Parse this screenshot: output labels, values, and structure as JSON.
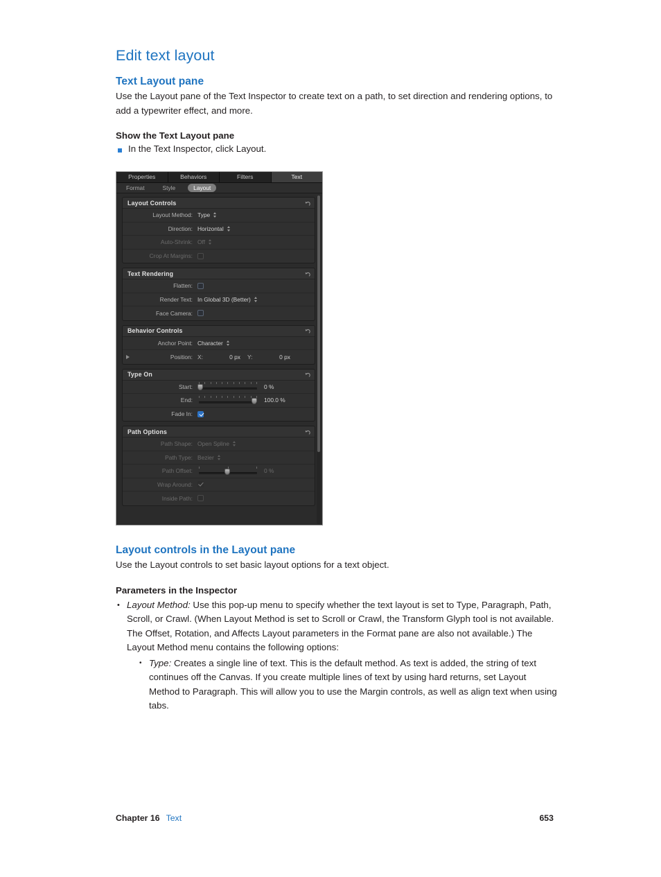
{
  "document": {
    "title": "Edit text layout",
    "sections": [
      {
        "heading": "Text Layout pane",
        "body": "Use the Layout pane of the Text Inspector to create text on a path, to set direction and rendering options, to add a typewriter effect, and more.",
        "subheading": "Show the Text Layout pane",
        "bullet": "In the Text Inspector, click Layout."
      },
      {
        "heading": "Layout controls in the Layout pane",
        "body": "Use the Layout controls to set basic layout options for a text object.",
        "subheading": "Parameters in the Inspector",
        "item_term": "Layout Method:",
        "item_text": " Use this pop-up menu to specify whether the text layout is set to Type, Paragraph, Path, Scroll, or Crawl. (When Layout Method is set to Scroll or Crawl, the Transform Glyph tool is not available. The Offset, Rotation, and Affects Layout parameters in the Format pane are also not available.) The Layout Method menu contains the following options:",
        "nested_term": "Type:",
        "nested_text": " Creates a single line of text. This is the default method. As text is added, the string of text continues off the Canvas. If you create multiple lines of text by using hard returns, set Layout Method to Paragraph. This will allow you to use the Margin controls, as well as align text when using tabs."
      }
    ]
  },
  "footer": {
    "chapter": "Chapter 16",
    "chapter_link": "Text",
    "page_number": "653"
  },
  "inspector": {
    "tabs": [
      {
        "label": "Properties",
        "active": false
      },
      {
        "label": "Behaviors",
        "active": false
      },
      {
        "label": "Filters",
        "active": false
      },
      {
        "label": "Text",
        "active": true
      }
    ],
    "subtabs": [
      {
        "label": "Format",
        "active": false
      },
      {
        "label": "Style",
        "active": false
      },
      {
        "label": "Layout",
        "active": true
      }
    ],
    "groups": [
      {
        "title": "Layout Controls",
        "rows": [
          {
            "label": "Layout Method:",
            "value": "Type",
            "control": "popup",
            "dim": false
          },
          {
            "label": "Direction:",
            "value": "Horizontal",
            "control": "popup",
            "dim": false
          },
          {
            "label": "Auto-Shrink:",
            "value": "Off",
            "control": "popup",
            "dim": true
          },
          {
            "label": "Crop At Margins:",
            "value": "",
            "control": "checkbox",
            "checked": false,
            "dim": true
          }
        ]
      },
      {
        "title": "Text Rendering",
        "rows": [
          {
            "label": "Flatten:",
            "value": "",
            "control": "checkbox",
            "checked": false,
            "dim": false
          },
          {
            "label": "Render Text:",
            "value": "In Global 3D (Better)",
            "control": "popup",
            "dim": false
          },
          {
            "label": "Face Camera:",
            "value": "",
            "control": "checkbox",
            "checked": false,
            "dim": false
          }
        ]
      },
      {
        "title": "Behavior Controls",
        "rows": [
          {
            "label": "Anchor Point:",
            "value": "Character",
            "control": "popup",
            "dim": false
          },
          {
            "label": "Position:",
            "control": "position",
            "x_label": "X:",
            "x_value": "0 px",
            "y_label": "Y:",
            "y_value": "0 px",
            "dim": false
          }
        ]
      },
      {
        "title": "Type On",
        "rows": [
          {
            "label": "Start:",
            "control": "slider",
            "value": "0 %",
            "knob_pct": 0,
            "dim": false
          },
          {
            "label": "End:",
            "control": "slider",
            "value": "100.0 %",
            "knob_pct": 100,
            "dim": false
          },
          {
            "label": "Fade In:",
            "control": "checkbox",
            "checked": true,
            "dim": false
          }
        ]
      },
      {
        "title": "Path Options",
        "rows": [
          {
            "label": "Path Shape:",
            "value": "Open Spline",
            "control": "popup",
            "dim": true
          },
          {
            "label": "Path Type:",
            "value": "Bezier",
            "control": "popup",
            "dim": true
          },
          {
            "label": "Path Offset:",
            "control": "slider",
            "value": "0 %",
            "knob_pct": 50,
            "dim": true
          },
          {
            "label": "Wrap Around:",
            "control": "plaincheck",
            "checked": true,
            "dim": true
          },
          {
            "label": "Inside Path:",
            "control": "checkbox",
            "checked": false,
            "dim": true
          }
        ]
      }
    ]
  }
}
